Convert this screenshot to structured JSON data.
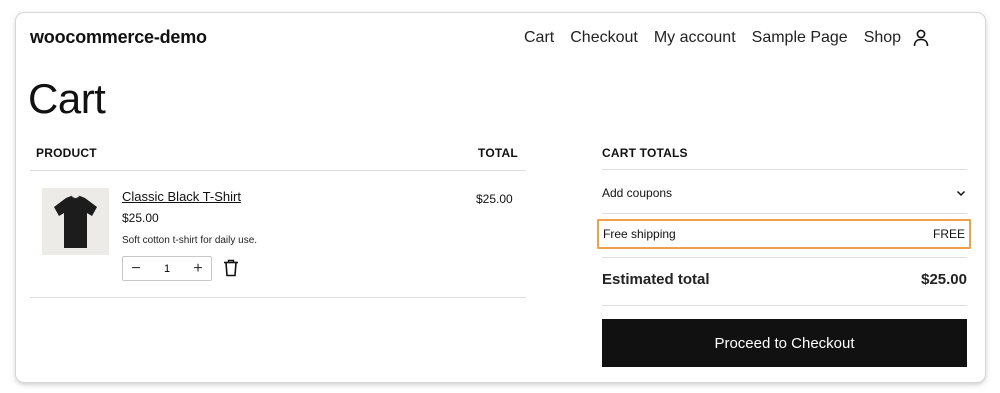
{
  "site": {
    "title": "woocommerce-demo"
  },
  "nav": {
    "items": [
      "Cart",
      "Checkout",
      "My account",
      "Sample Page",
      "Shop"
    ],
    "account_icon": "user-icon"
  },
  "page": {
    "title": "Cart"
  },
  "cart_table": {
    "headers": {
      "product": "PRODUCT",
      "total": "TOTAL"
    },
    "items": [
      {
        "name": "Classic Black T-Shirt",
        "price": "$25.00",
        "description": "Soft cotton t-shirt for daily use.",
        "quantity": "1",
        "line_total": "$25.00",
        "thumbnail_icon": "tshirt-icon"
      }
    ]
  },
  "cart_totals": {
    "heading": "CART TOTALS",
    "coupons_label": "Add coupons",
    "shipping_label": "Free shipping",
    "shipping_value": "FREE",
    "estimated_label": "Estimated total",
    "estimated_value": "$25.00",
    "checkout_button": "Proceed to Checkout"
  },
  "colors": {
    "highlight": "#f0a04b",
    "button_bg": "#111111",
    "button_text": "#ffffff"
  }
}
